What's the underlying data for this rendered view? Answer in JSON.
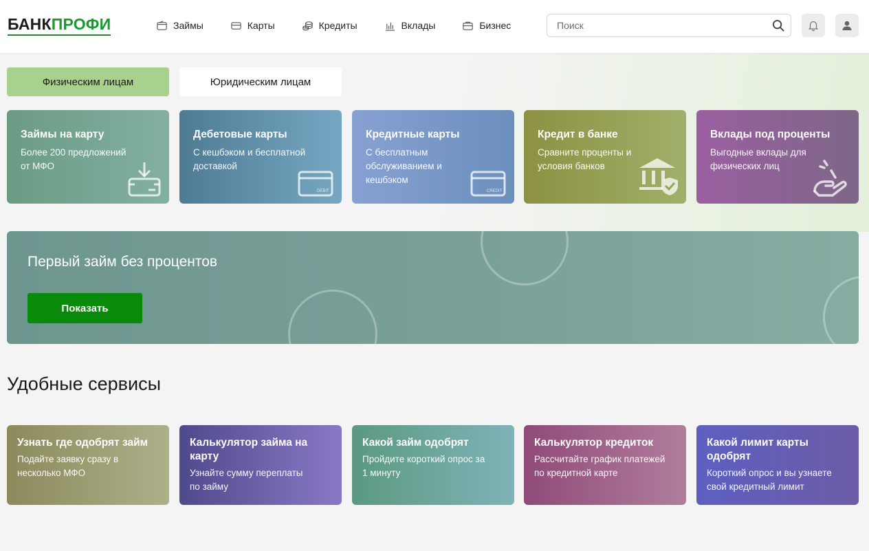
{
  "header": {
    "logo_part1": "БАНК",
    "logo_part2": "ПРОФИ",
    "nav": [
      {
        "label": "Займы",
        "icon": "wallet-icon"
      },
      {
        "label": "Карты",
        "icon": "card-icon"
      },
      {
        "label": "Кредиты",
        "icon": "coins-icon"
      },
      {
        "label": "Вклады",
        "icon": "chart-icon"
      },
      {
        "label": "Бизнес",
        "icon": "briefcase-icon"
      }
    ],
    "search_placeholder": "Поиск"
  },
  "segments": {
    "individuals": "Физическим лицам",
    "legal": "Юридическим лицам"
  },
  "products": [
    {
      "title": "Займы на карту",
      "desc": "Более 200 предложений от МФО",
      "icon": "download-card-icon"
    },
    {
      "title": "Дебетовые карты",
      "desc": "С кешбэком и бесплатной доставкой",
      "icon": "debit-card-icon",
      "icon_text": "DEBIT"
    },
    {
      "title": "Кредитные карты",
      "desc": "С бесплатным обслуживанием и кешбэком",
      "icon": "credit-card-icon",
      "icon_text": "CREDIT"
    },
    {
      "title": "Кредит в банке",
      "desc": "Сравните проценты и условия банков",
      "icon": "bank-shield-icon"
    },
    {
      "title": "Вклады под проценты",
      "desc": "Выгодные вклады для физических лиц",
      "icon": "hand-coin-icon"
    }
  ],
  "banner": {
    "title": "Первый займ без процентов",
    "button": "Показать"
  },
  "services_title": "Удобные сервисы",
  "services": [
    {
      "title": "Узнать где одобрят займ",
      "desc": "Подайте заявку сразу в несколько МФО"
    },
    {
      "title": "Калькулятор займа на карту",
      "desc": "Узнайте сумму переплаты по займу"
    },
    {
      "title": "Какой займ одобрят",
      "desc": "Пройдите короткий опрос за 1 минуту"
    },
    {
      "title": "Калькулятор кредиток",
      "desc": "Рассчитайте график платежей по кредитной карте"
    },
    {
      "title": "Какой лимит карты одобрят",
      "desc": "Короткий опрос и вы узнаете свой кредитный лимит"
    }
  ],
  "colors": {
    "accent_green": "#0a8a0a",
    "segment_active": "#a9d18e"
  }
}
